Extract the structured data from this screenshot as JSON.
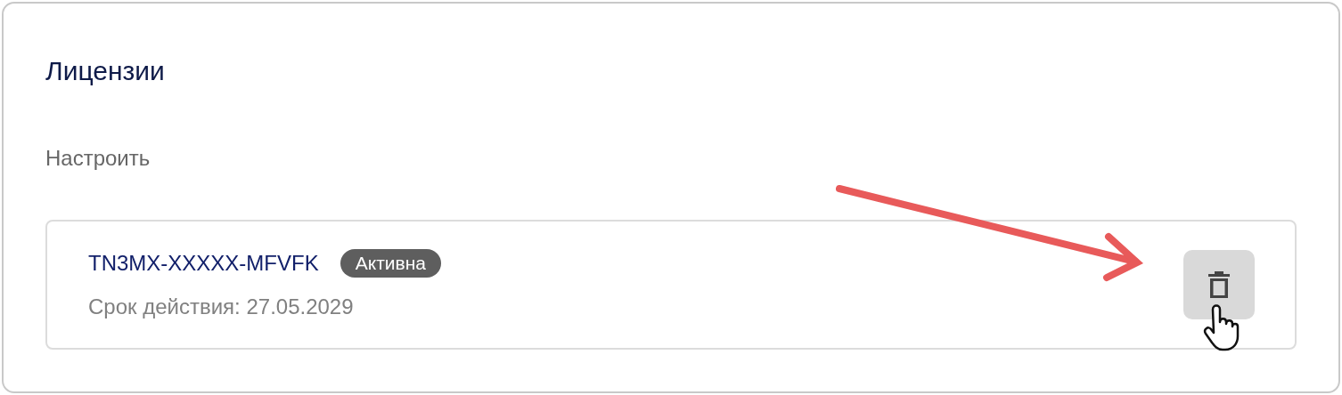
{
  "section": {
    "title": "Лицензии",
    "subtitle": "Настроить"
  },
  "licenses": [
    {
      "key": "TN3MX-XXXXX-MFVFK",
      "status": "Активна",
      "active": true,
      "expiry": "Срок действия: 27.05.2029"
    }
  ]
}
